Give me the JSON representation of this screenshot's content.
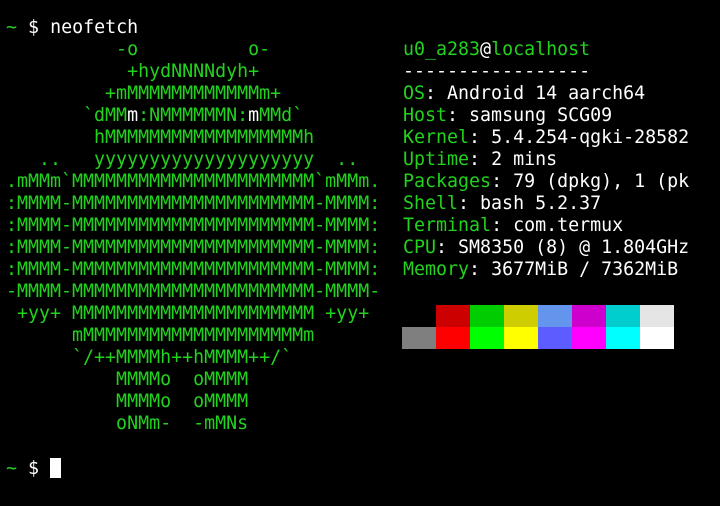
{
  "prompt_top": {
    "tilde": "~",
    "dollar": "$",
    "command": "neofetch"
  },
  "ascii_art": [
    "          -o          o-",
    "           +hydNNNNdyh+",
    "         +mMMMMMMMMMMMMm+",
    "       `dMM",
    "        hMMMMMMMMMMMMMMMMMMh",
    "   ..   yyyyyyyyyyyyyyyyyyyy  ..",
    ".mMMm`MMMMMMMMMMMMMMMMMMMMMM`mMMm.",
    ":MMMM-MMMMMMMMMMMMMMMMMMMMMM-MMMM:",
    ":MMMM-MMMMMMMMMMMMMMMMMMMMMM-MMMM:",
    ":MMMM-MMMMMMMMMMMMMMMMMMMMMM-MMMM:",
    ":MMMM-MMMMMMMMMMMMMMMMMMMMMM-MMMM:",
    "-MMMM-MMMMMMMMMMMMMMMMMMMMMM-MMMM-",
    " +yy+ MMMMMMMMMMMMMMMMMMMMMM +yy+",
    "      mMMMMMMMMMMMMMMMMMMMMm",
    "      `/++MMMMh++hMMMM++/`",
    "          MMMMo  oMMMM",
    "          MMMMo  oMMMM",
    "          oNMm-  -mMNs"
  ],
  "ascii_eyes_row": {
    "part1": "       `dMM",
    "eye1": "m",
    "part2": ":NMMMMMMN:",
    "eye2": "m",
    "part3": "MMd`"
  },
  "info": {
    "user": "u0_a283",
    "at": "@",
    "host": "localhost",
    "separator": "-----------------",
    "rows": [
      {
        "key": "OS",
        "value": "Android 14 aarch64"
      },
      {
        "key": "Host",
        "value": "samsung SCG09"
      },
      {
        "key": "Kernel",
        "value": "5.4.254-qgki-28582"
      },
      {
        "key": "Uptime",
        "value": "2 mins"
      },
      {
        "key": "Packages",
        "value": "79 (dpkg), 1 (pk"
      },
      {
        "key": "Shell",
        "value": "bash 5.2.37"
      },
      {
        "key": "Terminal",
        "value": "com.termux"
      },
      {
        "key": "CPU",
        "value": "SM8350 (8) @ 1.804GHz"
      },
      {
        "key": "Memory",
        "value": "3677MiB / 7362MiB"
      }
    ],
    "colon": ": "
  },
  "palette": {
    "normal": [
      "#000000",
      "#cd0000",
      "#00cd00",
      "#cdcd00",
      "#6495ed",
      "#cd00cd",
      "#00cdcd",
      "#e5e5e5"
    ],
    "bright": [
      "#7f7f7f",
      "#ff0000",
      "#00ff00",
      "#ffff00",
      "#5c5cff",
      "#ff00ff",
      "#00ffff",
      "#ffffff"
    ]
  },
  "prompt_bottom": {
    "tilde": "~",
    "dollar": "$"
  },
  "colors": {
    "accent_green": "#22d21e",
    "text": "#ffffff",
    "background": "#000000"
  }
}
